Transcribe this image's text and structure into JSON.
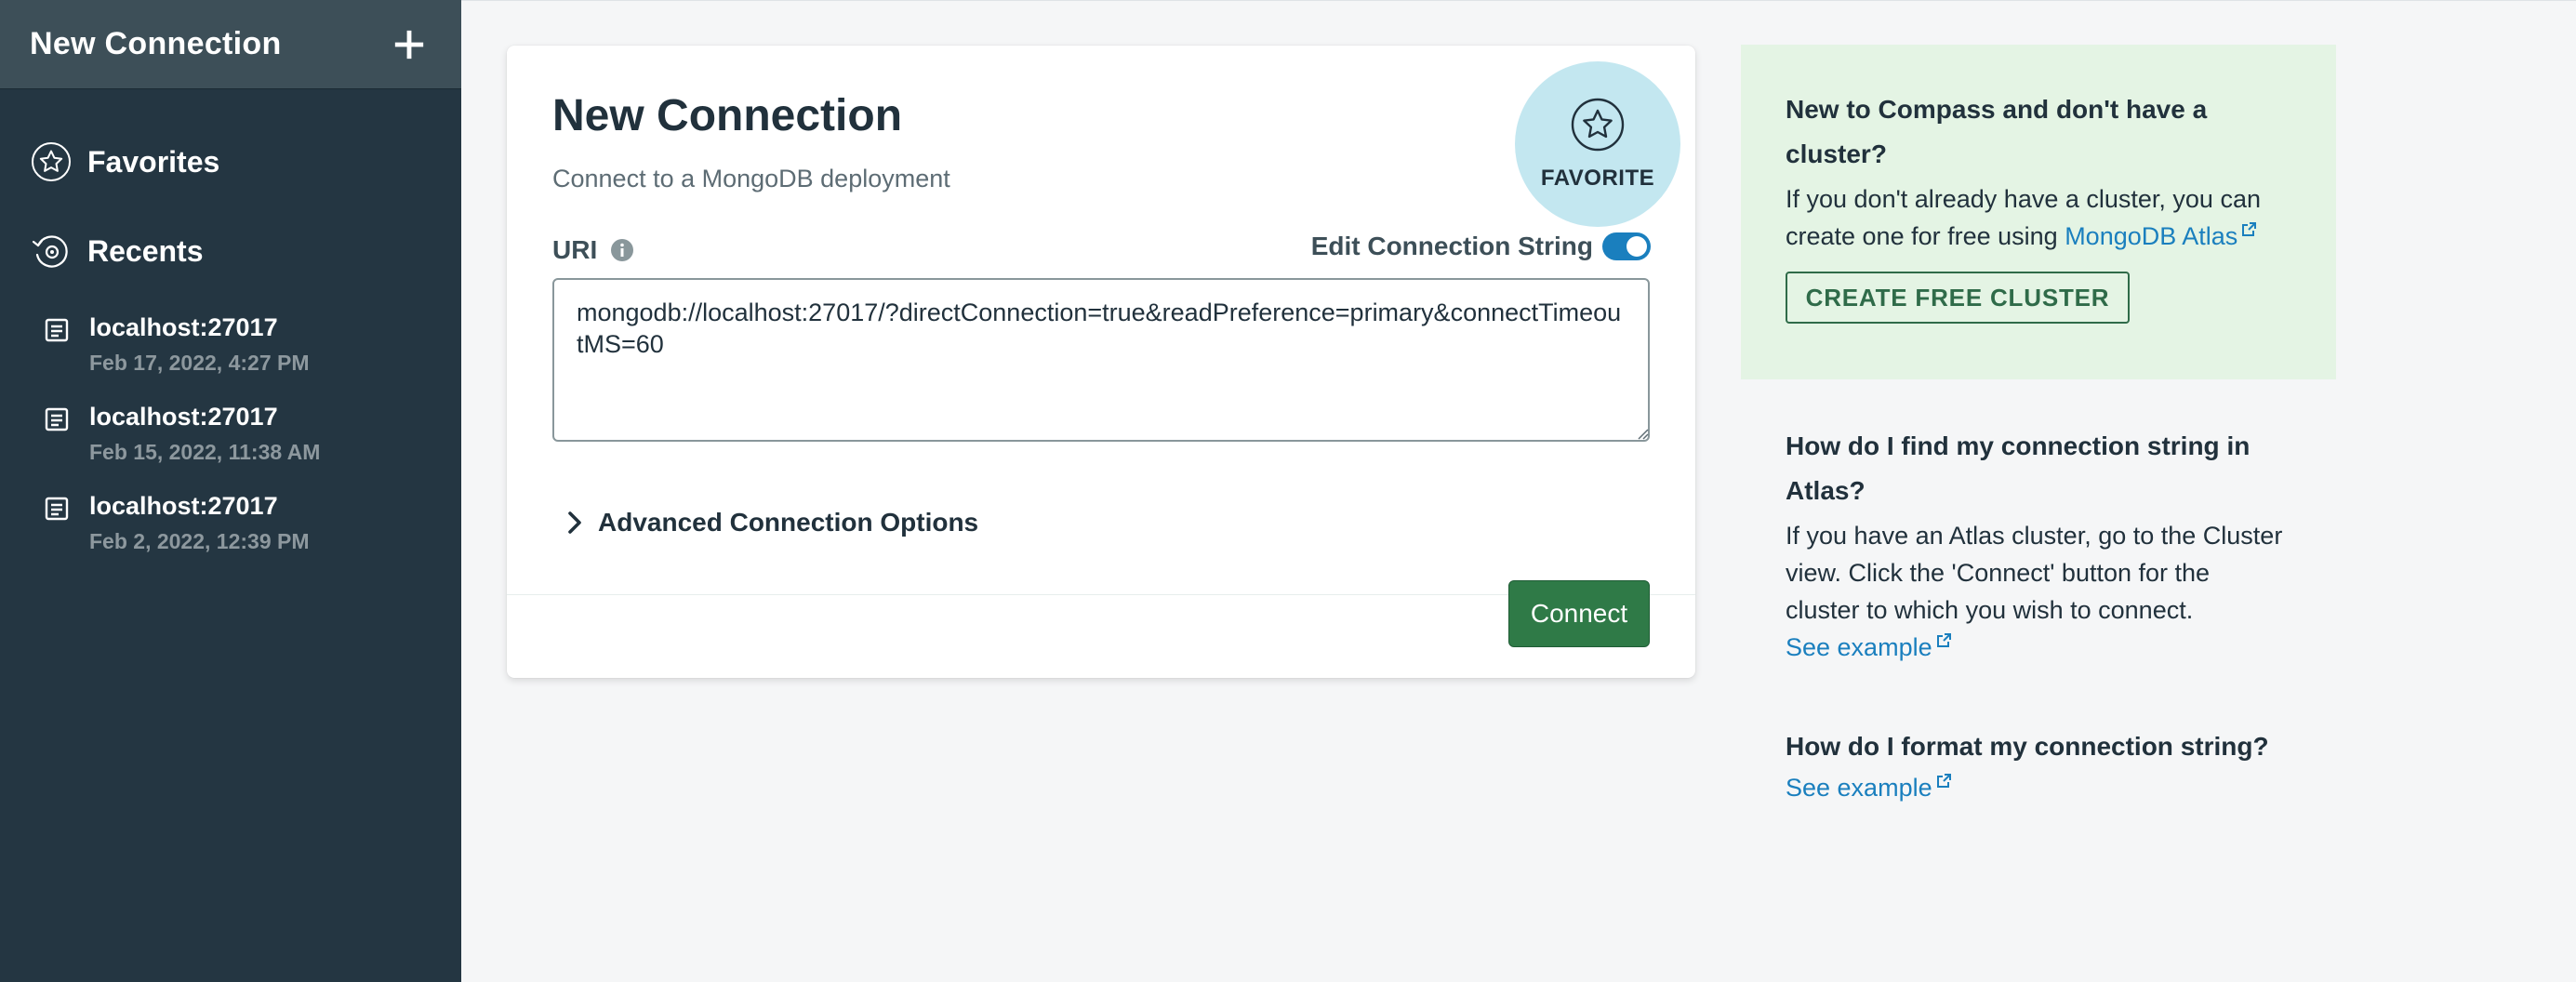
{
  "sidebar": {
    "title": "New Connection",
    "favorites_label": "Favorites",
    "recents_label": "Recents",
    "recents": [
      {
        "host": "localhost:27017",
        "date": "Feb 17, 2022, 4:27 PM"
      },
      {
        "host": "localhost:27017",
        "date": "Feb 15, 2022, 11:38 AM"
      },
      {
        "host": "localhost:27017",
        "date": "Feb 2, 2022, 12:39 PM"
      }
    ]
  },
  "card": {
    "title": "New Connection",
    "subtitle": "Connect to a MongoDB deployment",
    "favorite_label": "FAVORITE",
    "uri_label": "URI",
    "edit_string_label": "Edit Connection String",
    "edit_string_enabled": true,
    "uri_value": "mongodb://localhost:27017/?directConnection=true&readPreference=primary&connectTimeoutMS=60",
    "advanced_label": "Advanced Connection Options",
    "connect_label": "Connect"
  },
  "help": {
    "new_heading": "New to Compass and don't have a cluster?",
    "new_text": "If you don't already have a cluster, you can create one for free using ",
    "atlas_link": "MongoDB Atlas",
    "create_button": "CREATE FREE CLUSTER",
    "find_heading": "How do I find my connection string in Atlas?",
    "find_text": "If you have an Atlas cluster, go to the Cluster view. Click the 'Connect' button for the cluster to which you wish to connect.",
    "see_example_1": "See example",
    "format_heading": "How do I format my connection string?",
    "see_example_2": "See example"
  },
  "colors": {
    "sidebar_bg": "#243642",
    "sidebar_header_bg": "#3d4f58",
    "accent_blue": "#1a7fbe",
    "connect_green": "#2f7a47",
    "help_green_bg": "#e4f4e4",
    "favorite_bg": "#c3e7f0"
  },
  "icons": [
    "plus-icon",
    "star-icon",
    "history-icon",
    "connection-icon",
    "info-icon",
    "chevron-right-icon",
    "external-link-icon"
  ]
}
